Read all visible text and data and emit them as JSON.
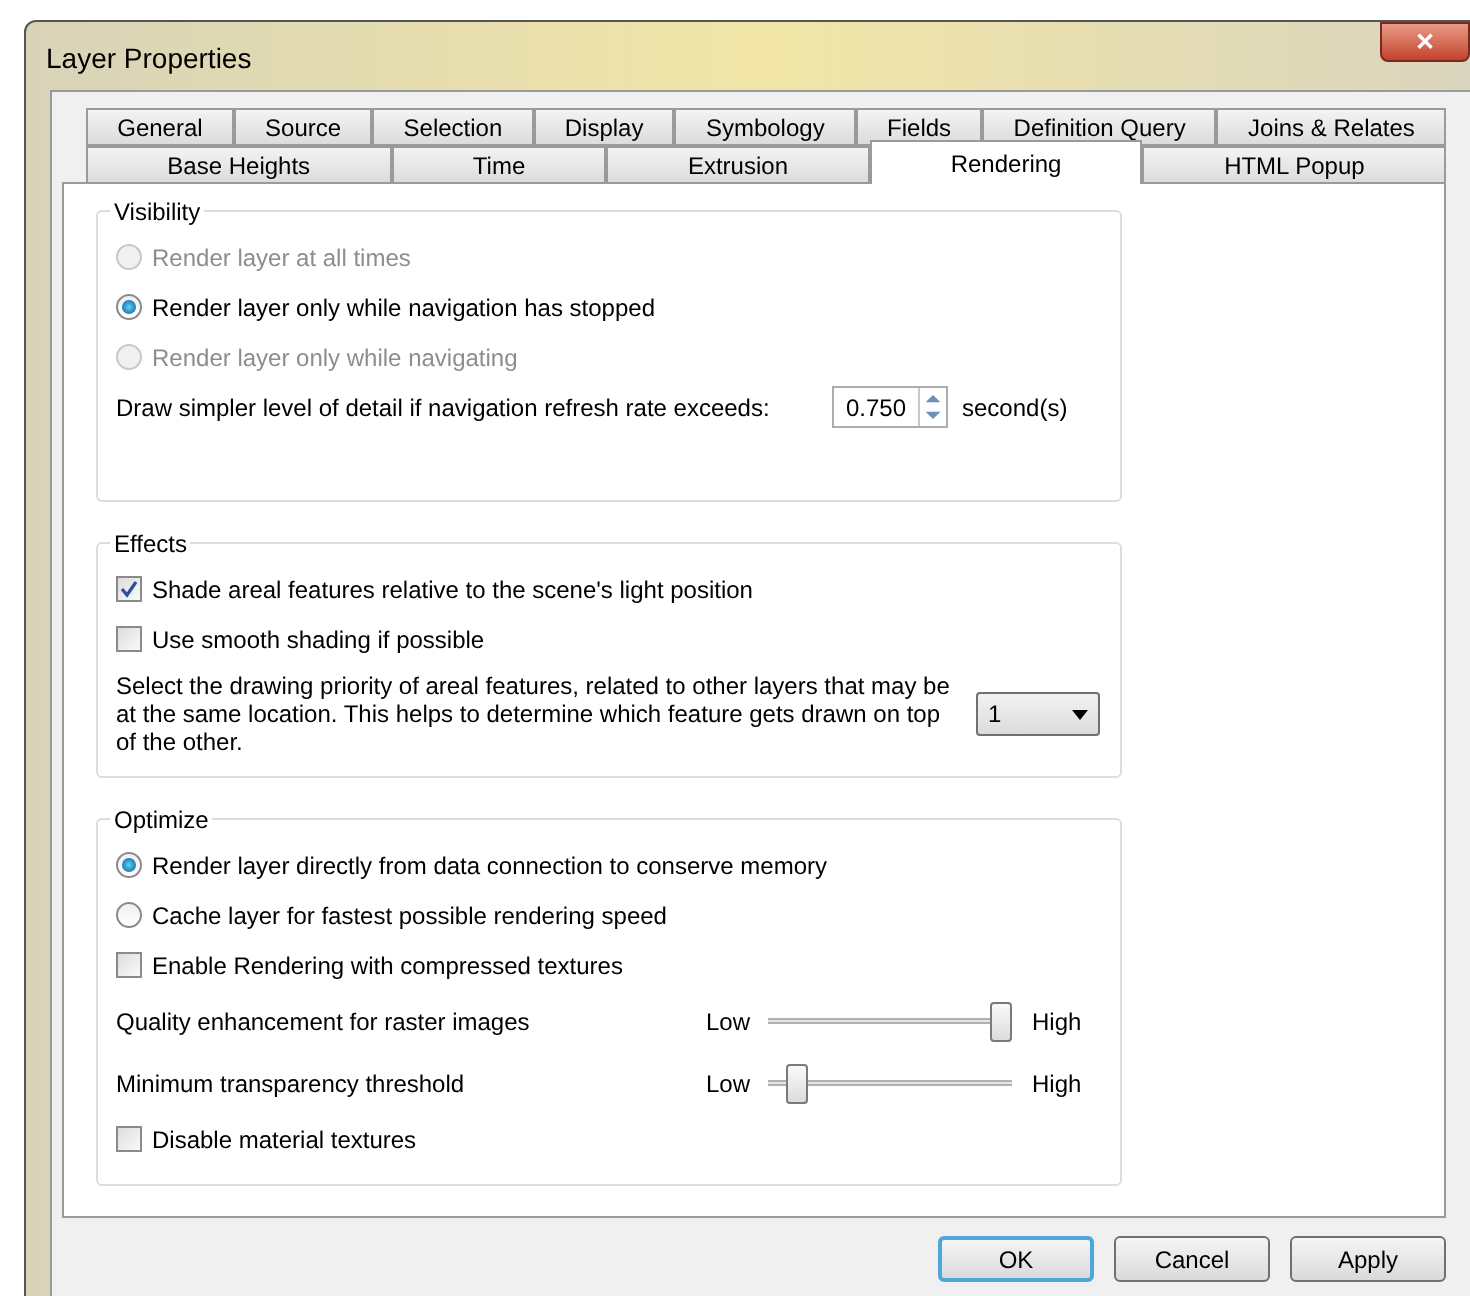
{
  "window": {
    "title": "Layer Properties",
    "close": "✕"
  },
  "tabs": [
    [
      {
        "label": "General",
        "selected": false
      },
      {
        "label": "Source",
        "selected": false
      },
      {
        "label": "Selection",
        "selected": false
      },
      {
        "label": "Display",
        "selected": false
      },
      {
        "label": "Symbology",
        "selected": false
      },
      {
        "label": "Fields",
        "selected": false
      },
      {
        "label": "Definition Query",
        "selected": false
      },
      {
        "label": "Joins & Relates",
        "selected": false
      }
    ],
    [
      {
        "label": "Base Heights",
        "selected": false
      },
      {
        "label": "Time",
        "selected": false
      },
      {
        "label": "Extrusion",
        "selected": false
      },
      {
        "label": "Rendering",
        "selected": true
      },
      {
        "label": "HTML Popup",
        "selected": false
      }
    ]
  ],
  "groups": [
    {
      "title": "Visibility",
      "items": [
        {
          "kind": "radio",
          "label": "Render layer at all times",
          "selected": false,
          "disabled": true
        },
        {
          "kind": "radio",
          "label": "Render layer only while navigation has stopped",
          "selected": true,
          "disabled": false
        },
        {
          "kind": "radio",
          "label": "Render layer only while navigating",
          "selected": false,
          "disabled": true
        },
        {
          "kind": "spinner",
          "label": "Draw simpler level of detail if navigation refresh rate exceeds:",
          "value": "0.750",
          "unit": "second(s)"
        }
      ]
    },
    {
      "title": "Effects",
      "items": [
        {
          "kind": "checkbox",
          "label": "Shade areal features relative to the scene's light position",
          "checked": true
        },
        {
          "kind": "checkbox",
          "label": "Use smooth shading if possible",
          "checked": false
        },
        {
          "kind": "dropdown",
          "label": "Select the drawing priority of areal features, related to other layers that may be at the same location. This helps to determine which feature gets drawn on top of the other.",
          "value": "1"
        }
      ]
    },
    {
      "title": "Optimize",
      "items": [
        {
          "kind": "radio",
          "label": "Render layer directly from data connection to conserve memory",
          "selected": true,
          "disabled": false
        },
        {
          "kind": "radio",
          "label": "Cache layer for fastest possible rendering speed",
          "selected": false,
          "disabled": false
        },
        {
          "kind": "checkbox",
          "label": "Enable Rendering with compressed textures",
          "checked": false
        },
        {
          "kind": "slider",
          "label": "Quality enhancement for raster images",
          "low": "Low",
          "high": "High",
          "level": 1
        },
        {
          "kind": "slider",
          "label": "Minimum transparency threshold",
          "low": "Low",
          "high": "High",
          "level": 0.08
        },
        {
          "kind": "checkbox",
          "label": "Disable material textures",
          "checked": false
        }
      ]
    }
  ],
  "buttons": [
    {
      "label": "OK",
      "default": true
    },
    {
      "label": "Cancel",
      "default": false
    },
    {
      "label": "Apply",
      "default": false
    }
  ]
}
